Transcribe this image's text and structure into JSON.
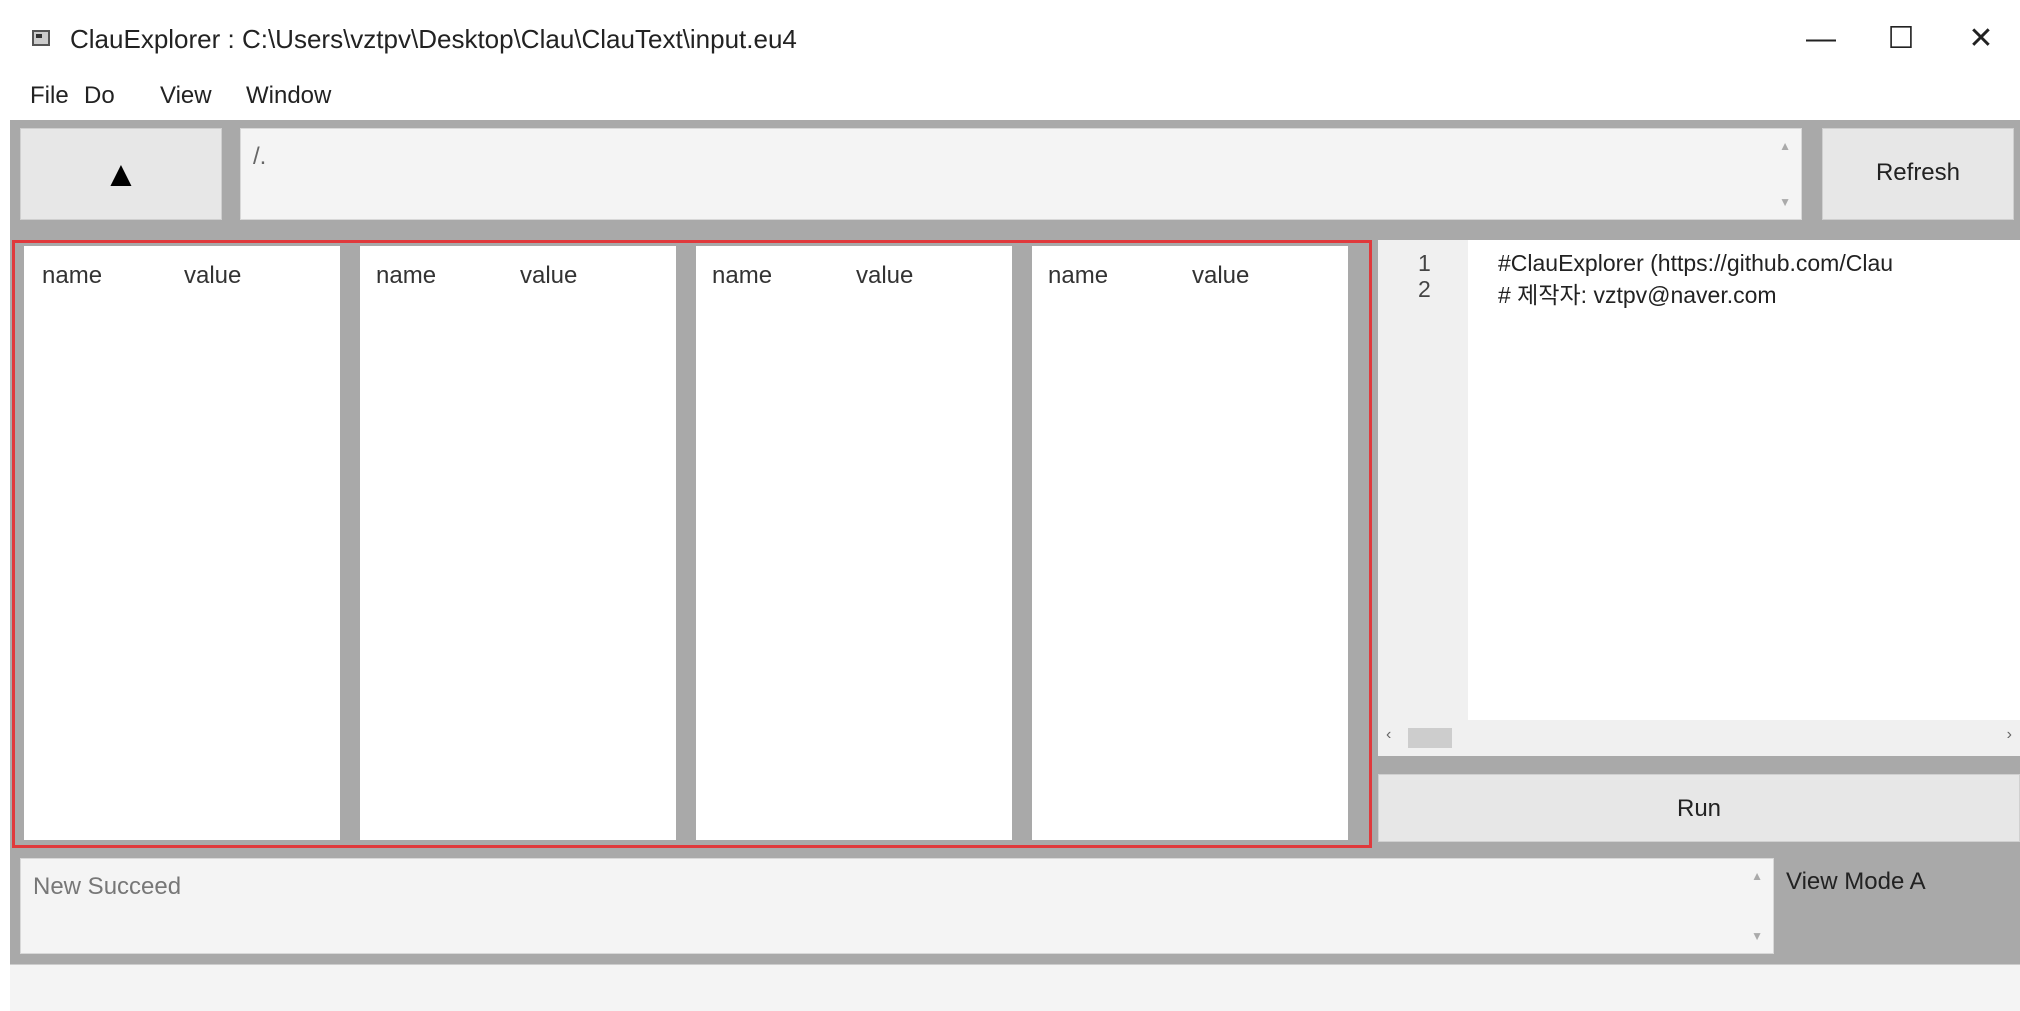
{
  "window": {
    "title": "ClauExplorer : C:\\Users\\vztpv\\Desktop\\Clau\\ClauText\\input.eu4",
    "minimize": "—",
    "maximize": "☐",
    "close": "✕"
  },
  "menu": [
    "File",
    "Do",
    "View",
    "Window"
  ],
  "toolbar": {
    "up_label": "▲",
    "path_value": "/.",
    "refresh_label": "Refresh"
  },
  "panels": [
    {
      "name_header": "name",
      "value_header": "value"
    },
    {
      "name_header": "name",
      "value_header": "value"
    },
    {
      "name_header": "name",
      "value_header": "value"
    },
    {
      "name_header": "name",
      "value_header": "value"
    }
  ],
  "editor": {
    "lines": [
      {
        "num": "1",
        "text": "#ClauExplorer (https://github.com/Clau"
      },
      {
        "num": "2",
        "text": "#       제작자: vztpv@naver.com"
      }
    ],
    "scroll_left": "‹",
    "scroll_right": "›"
  },
  "run_label": "Run",
  "log": {
    "text": "New Succeed"
  },
  "view_mode": "View Mode A"
}
